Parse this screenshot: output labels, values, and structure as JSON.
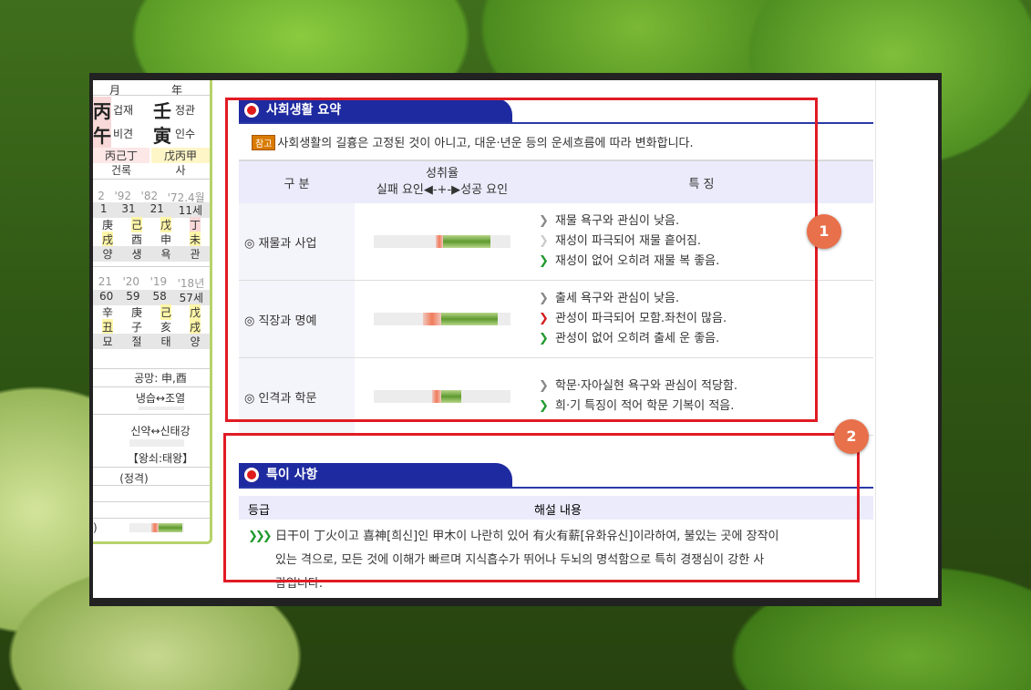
{
  "left_panel": {
    "month_label": "月",
    "year_label": "年",
    "stem_month": "丙",
    "stem_month_role": "겁재",
    "stem_year": "壬",
    "stem_year_role": "정관",
    "branch_month": "午",
    "branch_month_role": "비견",
    "branch_year": "寅",
    "branch_year_role": "인수",
    "hidden_month": "丙己丁",
    "hidden_year": "戊丙甲",
    "stage_month": "건록",
    "stage_year": "사",
    "daeun_years": [
      "2",
      "'92",
      "'82",
      "'72.4월"
    ],
    "daeun_ages": [
      "1",
      "31",
      "21",
      "11세"
    ],
    "daeun_stems": [
      "庚",
      "己",
      "戊",
      "丁"
    ],
    "daeun_branches": [
      "戌",
      "酉",
      "申",
      "未"
    ],
    "daeun_stages": [
      "양",
      "생",
      "욕",
      "관"
    ],
    "seun_years": [
      "21",
      "'20",
      "'19",
      "'18년"
    ],
    "seun_ages": [
      "60",
      "59",
      "58",
      "57세"
    ],
    "seun_stems": [
      "辛",
      "庚",
      "己",
      "戊"
    ],
    "seun_branches": [
      "丑",
      "子",
      "亥",
      "戌"
    ],
    "seun_stages": [
      "묘",
      "절",
      "태",
      "양"
    ],
    "gongmang": "공망: 申,酉",
    "temp": "냉습↔조열",
    "strength": "신약↔신태강",
    "wangsoe": "【왕쇠:태왕】",
    "gyeok": "(정격)",
    "last_row_marker": ")"
  },
  "section1": {
    "title": "사회생활 요약",
    "notice_badge": "참고",
    "notice_text": "사회생활의 길흉은 고정된 것이 아니고, 대운·년운 등의 운세흐름에 따라 변화합니다.",
    "col_category": "구 분",
    "col_achievement_top": "성취율",
    "col_achievement_bottom": "실패 요인◀-+-▶성공 요인",
    "col_feature": "특 징",
    "rows": [
      {
        "category": "◎ 재물과 사업",
        "features": [
          "재물 욕구와 관심이 낮음.",
          "재성이 파극되어 재물 흩어짐.",
          "재성이 없어 오히려 재물 복 좋음."
        ]
      },
      {
        "category": "◎ 직장과 명예",
        "features": [
          "출세 욕구와 관심이 낮음.",
          "관성이 파극되어 모함.좌천이 많음.",
          "관성이 없어 오히려 출세 운 좋음."
        ]
      },
      {
        "category": "◎ 인격과 학문",
        "features": [
          "학문·자아실현 욕구와 관심이 적당함.",
          "희·기 특징이 적어 학문 기복이 적음."
        ]
      }
    ]
  },
  "section2": {
    "title": "특이 사항",
    "col_grade": "등급",
    "col_desc": "해설 내용",
    "grade_icon": "❯❯❯",
    "desc_line1": "日干이 丁火이고 喜神[희신]인 甲木이 나란히 있어 有火有薪[유화유신]이라하여, 불있는 곳에 장작이",
    "desc_line2": "있는 격으로, 모든 것에 이해가 빠르며 지식흡수가 뛰어나 두뇌의 명석함으로 특히 경쟁심이 강한 사",
    "desc_line3": "람입니다."
  },
  "callouts": [
    "1",
    "2"
  ],
  "colors": {
    "header_blue": "#1e2aa0",
    "highlight_red": "#e01b24",
    "callout_orange": "#e8704a"
  }
}
